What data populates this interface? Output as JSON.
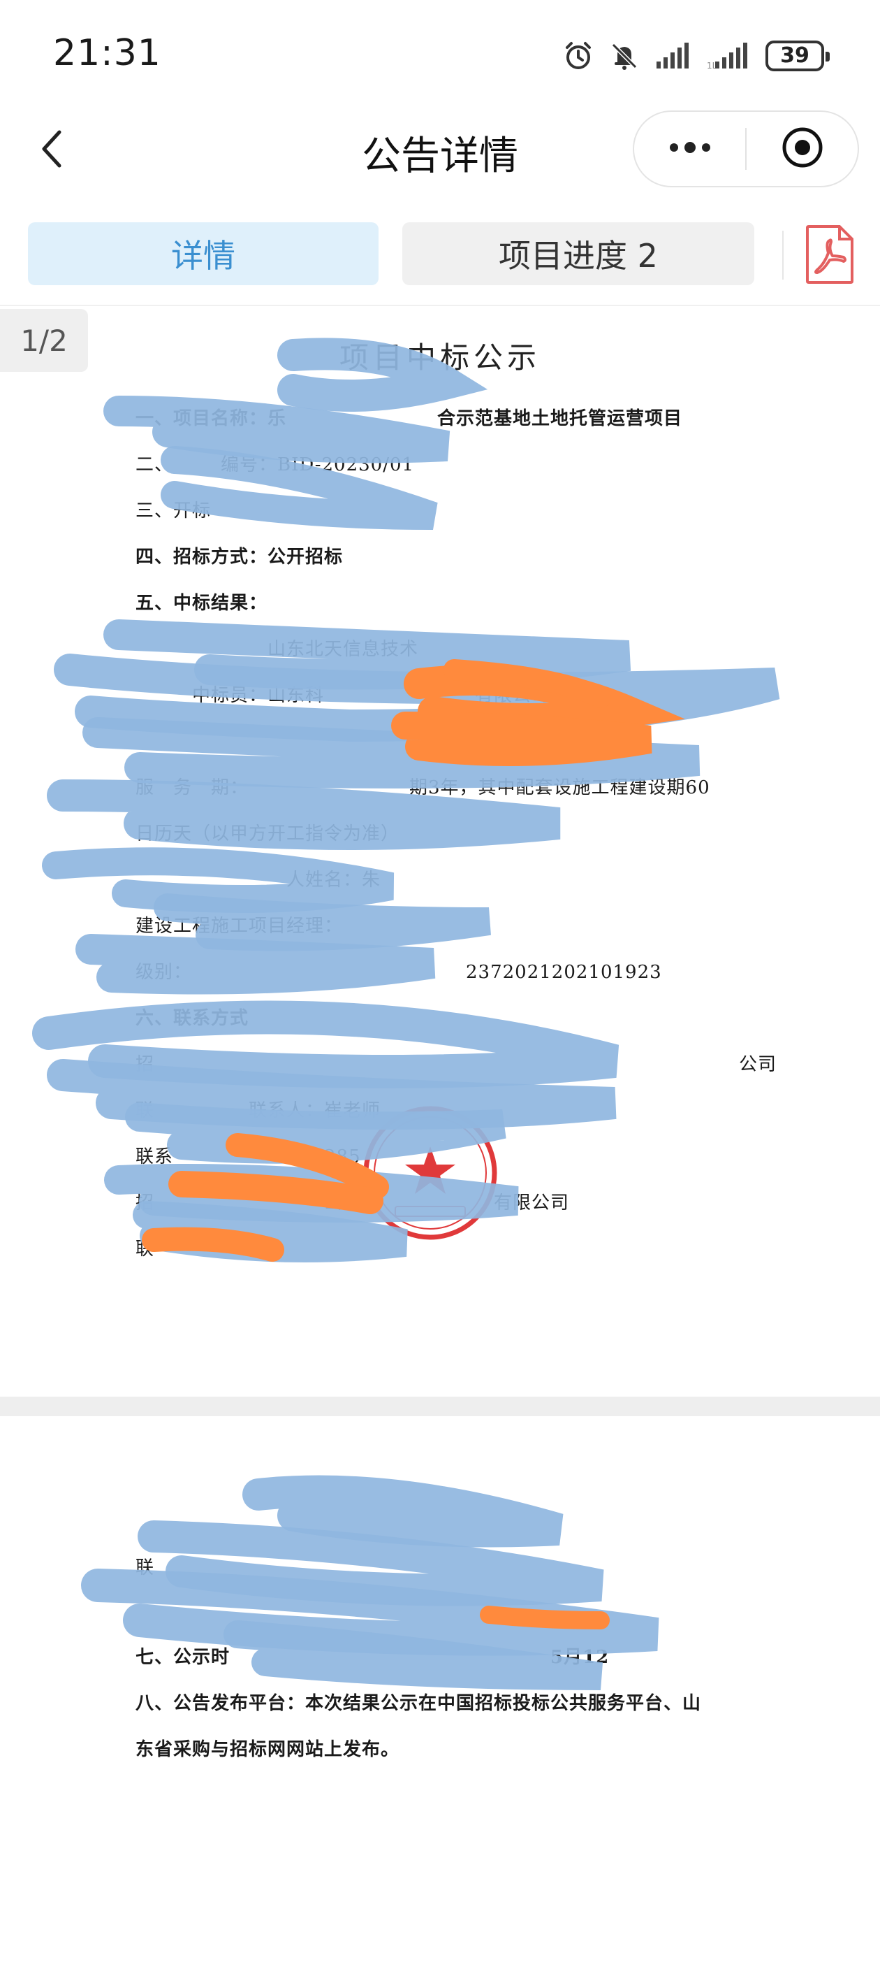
{
  "status_bar": {
    "time": "21:31",
    "battery": "39",
    "icons": [
      "alarm-icon",
      "mute-bell-icon",
      "signal-icon",
      "signal-icon"
    ]
  },
  "nav": {
    "title": "公告详情",
    "back_icon": "chevron-left-icon",
    "more_icon": "more-dots-icon",
    "close_icon": "target-icon"
  },
  "tabs": [
    {
      "label": "详情",
      "active": true
    },
    {
      "label": "项目进度 2",
      "active": false
    }
  ],
  "pdf_icon": "pdf-icon",
  "viewer": {
    "page_indicator": "1/2"
  },
  "document": {
    "title": "项目中标公示",
    "page1_lines": [
      {
        "text": "一、项目名称：乐　　　　　　　　合示范基地土地托管运营项目",
        "bold": true
      },
      {
        "text": "二、　　　编号：BID-20230/01",
        "bold": false
      },
      {
        "text": "三、开标　　　　　",
        "bold": false
      },
      {
        "text": "四、招标方式：公开招标",
        "bold": true
      },
      {
        "text": "五、中标结果：",
        "bold": true
      },
      {
        "text": "　　　　　　　山东北天信息技术",
        "bold": false
      },
      {
        "text": "　　　中标员：山东科　　　　　　　　有限公司",
        "bold": false
      },
      {
        "text": "　　　　　　　　　　　　　　　　　　　　　　　　　　　　　　　　　　　　",
        "bold": false
      },
      {
        "text": "服　务　期：　　　　　　　　　期3年，其中配套设施工程建设期60",
        "bold": false
      },
      {
        "text": "日历天（以甲方开工指令为准）",
        "bold": false
      },
      {
        "text": "　　　　　　　　人姓名：朱　　",
        "bold": false
      },
      {
        "text": "建设工程施工项目经理：",
        "bold": false
      },
      {
        "text": "级别：　　　　　　　　　　　　　　　2372021202101923",
        "bold": false
      },
      {
        "text": "六、联系方式",
        "bold": true
      },
      {
        "text": "招　　　　　　　　　　　　　　　　　　　　　　　　　　　　　　　公司",
        "bold": false
      },
      {
        "text": "联　　　　　联系人：崔老师",
        "bold": false
      },
      {
        "text": "联系　　　　　　　　285",
        "bold": false
      },
      {
        "text": "招　　　　　　　　　山　　　　　　　　有限公司",
        "bold": false
      },
      {
        "text": "联　　",
        "bold": false
      }
    ],
    "page2_lines": [
      {
        "text": "联　　　　　　　　　　　　　　　　　　　　",
        "bold": false
      },
      {
        "text": "七、公示时　　　　　　　　　　　　　　　　　5月12",
        "bold": true
      },
      {
        "text": "八、公告发布平台：本次结果公示在中国招标投标公共服务平台、山",
        "bold": true
      },
      {
        "text": "东省采购与招标网网站上发布。",
        "bold": true
      }
    ]
  },
  "colors": {
    "tab_active_bg": "#dff0fb",
    "tab_active_text": "#3a8fd0",
    "pdf_red": "#e35f5f",
    "redaction_blue": "#8fb6e0",
    "redaction_orange": "#ff8a3d",
    "seal_red": "#e0393a"
  }
}
